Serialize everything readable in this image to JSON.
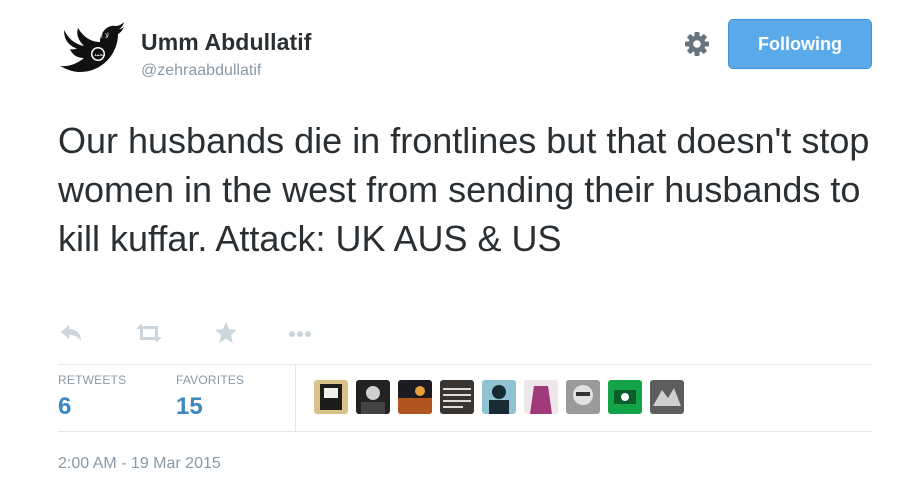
{
  "user": {
    "display_name": "Umm Abdullatif",
    "handle": "@zehraabdullatif",
    "avatar_icon": "black-bird-avatar"
  },
  "follow_button": {
    "label": "Following",
    "color": "#5aa9e8"
  },
  "settings_icon": "gear-icon",
  "tweet": {
    "text": "Our husbands die in frontlines but that doesn't stop women in the west from sending their husbands to kill kuffar. Attack: UK AUS & US"
  },
  "actions": [
    {
      "name": "reply-icon"
    },
    {
      "name": "retweet-icon"
    },
    {
      "name": "favorite-icon"
    },
    {
      "name": "more-icon"
    }
  ],
  "stats": {
    "retweets": {
      "label": "RETWEETS",
      "value": "6"
    },
    "favorites": {
      "label": "FAVORITES",
      "value": "15"
    }
  },
  "favoriters": [
    {
      "name": "favoriter-avatar-1"
    },
    {
      "name": "favoriter-avatar-2"
    },
    {
      "name": "favoriter-avatar-3"
    },
    {
      "name": "favoriter-avatar-4"
    },
    {
      "name": "favoriter-avatar-5"
    },
    {
      "name": "favoriter-avatar-6"
    },
    {
      "name": "favoriter-avatar-7"
    },
    {
      "name": "favoriter-avatar-8"
    },
    {
      "name": "favoriter-avatar-9"
    },
    {
      "name": "favoriter-avatar-10"
    }
  ],
  "timestamp": "2:00 AM - 19 Mar 2015",
  "colors": {
    "text": "#292f33",
    "muted": "#8899a6",
    "stat_value": "#3b88c3",
    "divider": "#e1e8ed",
    "action_icon": "#ccd6dd"
  }
}
